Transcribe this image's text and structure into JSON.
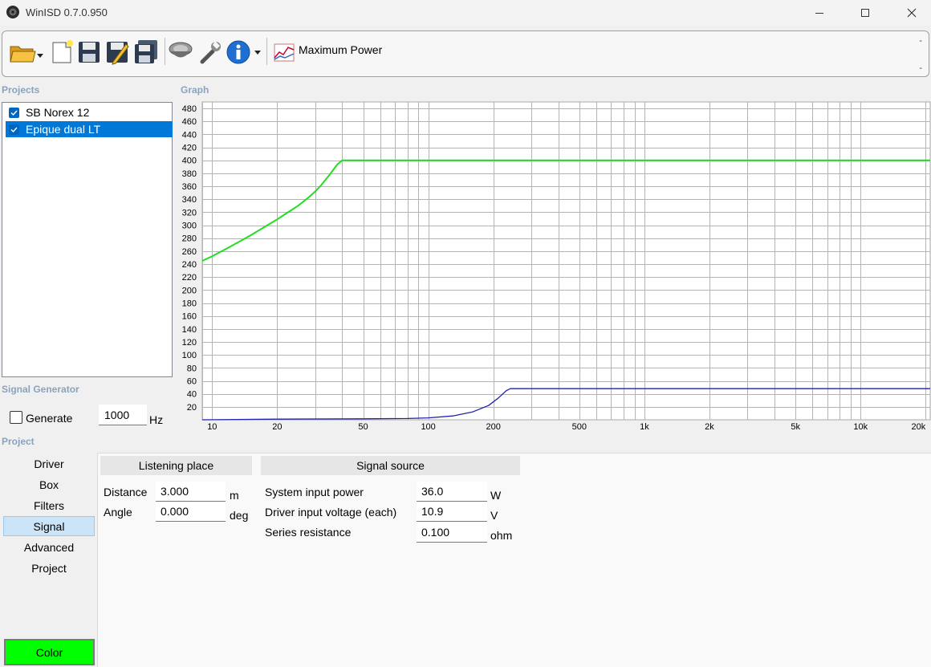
{
  "window": {
    "title": "WinISD 0.7.0.950"
  },
  "toolbar": {
    "graph_select_label": "Maximum Power",
    "right_dashes": [
      "-",
      "-"
    ]
  },
  "projects": {
    "section_label": "Projects",
    "items": [
      {
        "label": "SB Norex 12",
        "checked": true,
        "selected": false
      },
      {
        "label": "Epique dual LT",
        "checked": true,
        "selected": true
      }
    ]
  },
  "graph": {
    "section_label": "Graph",
    "colors": {
      "series1": "#22dd22",
      "series2": "#2222aa",
      "grid": "#b4b4b4"
    }
  },
  "chart_data": {
    "type": "line",
    "xscale": "log",
    "xlim": [
      9,
      21000
    ],
    "ylim": [
      0,
      490
    ],
    "grid": true,
    "y_ticks": [
      20,
      40,
      60,
      80,
      100,
      120,
      140,
      160,
      180,
      200,
      220,
      240,
      260,
      280,
      300,
      320,
      340,
      360,
      380,
      400,
      420,
      440,
      460,
      480
    ],
    "x_ticks": [
      {
        "value": 10,
        "label": "10"
      },
      {
        "value": 20,
        "label": "20"
      },
      {
        "value": 50,
        "label": "50"
      },
      {
        "value": 100,
        "label": "100"
      },
      {
        "value": 200,
        "label": "200"
      },
      {
        "value": 500,
        "label": "500"
      },
      {
        "value": 1000,
        "label": "1k"
      },
      {
        "value": 2000,
        "label": "2k"
      },
      {
        "value": 5000,
        "label": "5k"
      },
      {
        "value": 10000,
        "label": "10k"
      },
      {
        "value": 20000,
        "label": "20k"
      }
    ],
    "series": [
      {
        "color": "#22dd22",
        "x": [
          9,
          10,
          12,
          15,
          18,
          20,
          22,
          25,
          28,
          30,
          32,
          35,
          38,
          40,
          45,
          100,
          1000,
          10000,
          21000
        ],
        "y": [
          245,
          252,
          266,
          284,
          300,
          309,
          318,
          330,
          343,
          352,
          362,
          378,
          394,
          400,
          400,
          400,
          400,
          400,
          400
        ]
      },
      {
        "color": "#2222aa",
        "x": [
          9,
          20,
          50,
          80,
          100,
          130,
          160,
          190,
          210,
          230,
          240,
          300,
          1000,
          10000,
          21000
        ],
        "y": [
          0,
          1,
          1.5,
          2,
          3,
          6,
          12,
          22,
          33,
          45,
          48,
          48,
          48,
          48,
          48
        ]
      }
    ]
  },
  "signal_generator": {
    "section_label": "Signal Generator",
    "generate_label": "Generate",
    "generate_checked": false,
    "frequency_value": "1000",
    "frequency_unit": "Hz"
  },
  "project_nav": {
    "section_label": "Project",
    "items": [
      "Driver",
      "Box",
      "Filters",
      "Signal",
      "Advanced",
      "Project"
    ],
    "active": "Signal",
    "color_button_label": "Color"
  },
  "signal_panel": {
    "listening_place": {
      "header": "Listening place",
      "fields": [
        {
          "label": "Distance",
          "value": "3.000",
          "unit": "m"
        },
        {
          "label": "Angle",
          "value": "0.000",
          "unit": "deg"
        }
      ]
    },
    "signal_source": {
      "header": "Signal source",
      "fields": [
        {
          "label": "System input power",
          "value": "36.0",
          "unit": "W"
        },
        {
          "label": "Driver input voltage (each)",
          "value": "10.9",
          "unit": "V"
        },
        {
          "label": "Series resistance",
          "value": "0.100",
          "unit": "ohm"
        }
      ]
    }
  }
}
